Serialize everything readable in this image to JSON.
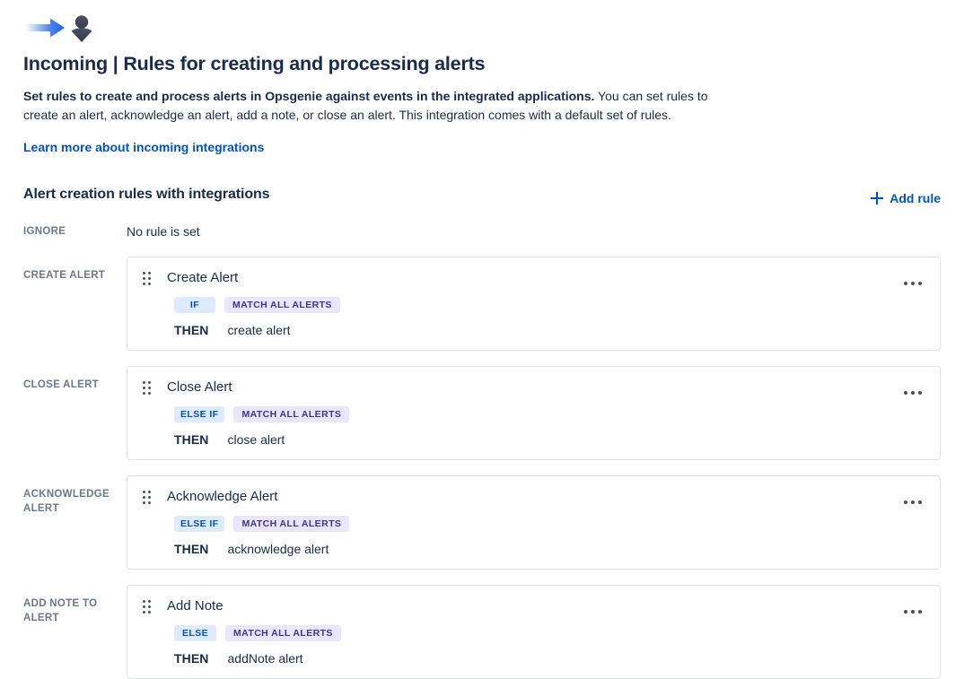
{
  "header": {
    "icon": "incoming-integration-icon",
    "title": "Incoming | Rules for creating and processing alerts",
    "intro_bold": "Set rules to create and process alerts in Opsgenie against events in the integrated applications.",
    "intro_rest": " You can set rules to create an alert, acknowledge an alert, add a note, or close an alert. This integration comes with a default set of rules.",
    "learn_more_link": "Learn more about incoming integrations"
  },
  "section": {
    "title": "Alert creation rules with integrations",
    "add_rule_label": "Add rule",
    "add_icon": "plus-icon"
  },
  "colors": {
    "link": "#0052CC",
    "text": "#172B4D",
    "label": "#6B778C",
    "badge_cond_bg": "#DEEBFF",
    "badge_cond_fg": "#0052CC",
    "badge_match_bg": "#EAE6FF",
    "badge_match_fg": "#403294",
    "card_border": "#DFE1E6"
  },
  "ignore": {
    "label": "IGNORE",
    "empty_text": "No rule is set"
  },
  "then_keyword": "THEN",
  "rules": [
    {
      "label": "CREATE ALERT",
      "title": "Create Alert",
      "condition": "IF",
      "match": "MATCH ALL ALERTS",
      "then": "create alert",
      "drag_icon": "drag-handle-icon",
      "more_icon": "more-actions-icon"
    },
    {
      "label": "CLOSE ALERT",
      "title": "Close Alert",
      "condition": "ELSE IF",
      "match": "MATCH ALL ALERTS",
      "then": "close alert",
      "drag_icon": "drag-handle-icon",
      "more_icon": "more-actions-icon"
    },
    {
      "label": "ACKNOWLEDGE ALERT",
      "title": "Acknowledge Alert",
      "condition": "ELSE IF",
      "match": "MATCH ALL ALERTS",
      "then": "acknowledge alert",
      "drag_icon": "drag-handle-icon",
      "more_icon": "more-actions-icon"
    },
    {
      "label": "ADD NOTE TO ALERT",
      "title": "Add Note",
      "condition": "ELSE",
      "match": "MATCH ALL ALERTS",
      "then": "addNote alert",
      "drag_icon": "drag-handle-icon",
      "more_icon": "more-actions-icon"
    }
  ]
}
